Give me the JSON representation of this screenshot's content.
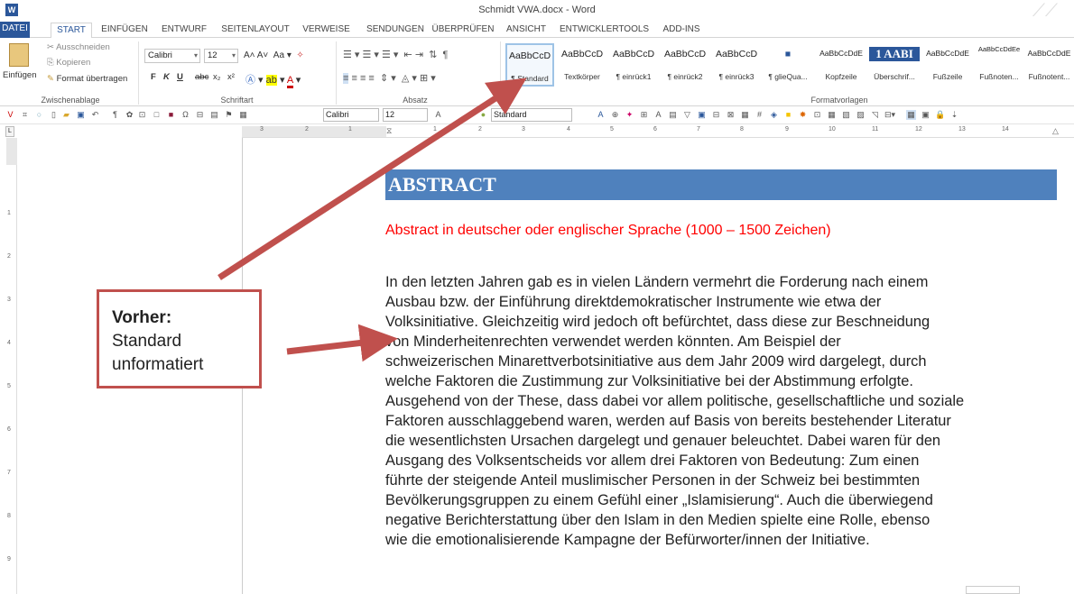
{
  "window": {
    "title": "Schmidt VWA.docx - Word",
    "icon": "word-app-icon"
  },
  "tabs": [
    "DATEI",
    "START",
    "EINFÜGEN",
    "ENTWURF",
    "SEITENLAYOUT",
    "VERWEISE",
    "SENDUNGEN",
    "ÜBERPRÜFEN",
    "ANSICHT",
    "ENTWICKLERTOOLS",
    "ADD-INS"
  ],
  "clipboard": {
    "paste": "Einfügen",
    "cut": "Ausschneiden",
    "copy": "Kopieren",
    "format_painter": "Format übertragen",
    "group": "Zwischenablage"
  },
  "font": {
    "name": "Calibri",
    "size": "12",
    "group": "Schriftart",
    "bold": "F",
    "italic": "K",
    "underline": "U",
    "strike": "abc",
    "sub": "x₂",
    "sup": "x²"
  },
  "paragraph": {
    "group": "Absatz"
  },
  "styles": {
    "group": "Formatvorlagen",
    "items": [
      {
        "sample": "AaBbCcD",
        "name": "¶ Standard"
      },
      {
        "sample": "AaBbCcD",
        "name": "Textkörper"
      },
      {
        "sample": "AaBbCcD",
        "name": "¶ einrück1"
      },
      {
        "sample": "AaBbCcD",
        "name": "¶ einrück2"
      },
      {
        "sample": "AaBbCcD",
        "name": "¶ einrück3"
      },
      {
        "sample": "■",
        "name": "¶ glieQua..."
      },
      {
        "sample": "AaBbCcDdE",
        "name": "Kopfzeile"
      },
      {
        "sample": "1 AABI",
        "name": "Überschrif..."
      },
      {
        "sample": "AaBbCcDdE",
        "name": "Fußzeile"
      },
      {
        "sample": "AaBbCcDdEe",
        "name": "Fußnoten..."
      },
      {
        "sample": "AaBbCcDdE",
        "name": "Fußnotent..."
      }
    ]
  },
  "quickbar": {
    "font": "Calibri",
    "size": "12",
    "style": "Standard"
  },
  "ruler": {
    "numbers": [
      "3",
      "2",
      "1",
      "1",
      "2",
      "3",
      "4",
      "5",
      "6",
      "7",
      "8",
      "9",
      "10",
      "11",
      "12",
      "13",
      "14"
    ]
  },
  "vruler": {
    "numbers": [
      "1",
      "2",
      "3",
      "4",
      "5",
      "6",
      "7",
      "8",
      "9"
    ]
  },
  "document": {
    "heading": "ABSTRACT",
    "subheading": "Abstract in deutscher oder englischer Sprache (1000 – 1500 Zeichen)",
    "lines": [
      "In den letzten Jahren gab es in vielen Ländern vermehrt die Forderung nach einem",
      "Ausbau bzw. der Einführung direktdemokratischer Instrumente wie etwa der",
      "Volksinitiative. Gleichzeitig wird jedoch oft befürchtet, dass diese zur Beschneidung",
      "von Minderheitenrechten verwendet werden könnten. Am Beispiel der",
      "schweizerischen Minarettverbotsinitiative aus dem Jahr 2009 wird dargelegt, durch",
      "welche Faktoren die Zustimmung zur Volksinitiative bei der Abstimmung erfolgte.",
      "Ausgehend von der These, dass dabei vor allem politische, gesellschaftliche und soziale",
      "Faktoren ausschlaggebend waren, werden auf Basis von bereits bestehender Literatur",
      "die wesentlichsten Ursachen dargelegt und genauer beleuchtet. Dabei waren für den",
      "Ausgang des Volksentscheids vor allem drei Faktoren von Bedeutung: Zum einen",
      "führte der steigende Anteil muslimischer Personen in der Schweiz bei bestimmten",
      "Bevölkerungsgruppen zu einem Gefühl einer „Islamisierung“. Auch die überwiegend",
      "negative Berichterstattung über den Islam in den Medien spielte eine Rolle, ebenso",
      "wie die emotionalisierende Kampagne der Befürworter/innen der Initiative."
    ]
  },
  "callout": {
    "title": "Vorher:",
    "line1": "Standard",
    "line2": "unformatiert"
  },
  "colors": {
    "accent": "#2b579a",
    "heading_bar": "#4f81bd",
    "subheading": "#ff0000",
    "annotation": "#c0504d"
  }
}
